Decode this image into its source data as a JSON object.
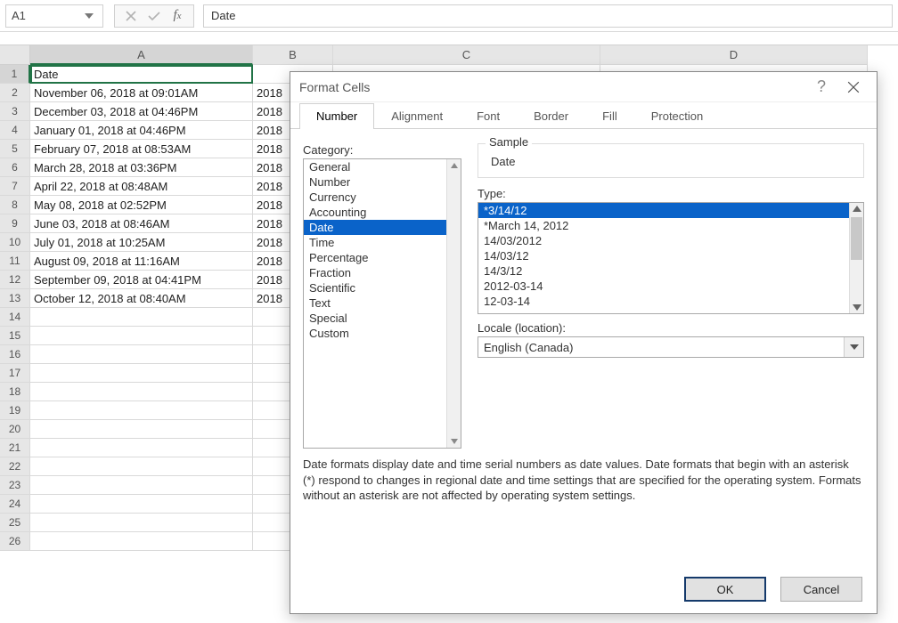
{
  "namebox": "A1",
  "formula_value": "Date",
  "columns": [
    "A",
    "B",
    "C",
    "D"
  ],
  "rows": [
    {
      "n": "1",
      "a": "Date",
      "b": ""
    },
    {
      "n": "2",
      "a": "November 06, 2018 at 09:01AM",
      "b": "2018"
    },
    {
      "n": "3",
      "a": "December 03, 2018 at 04:46PM",
      "b": "2018"
    },
    {
      "n": "4",
      "a": "January 01, 2018 at 04:46PM",
      "b": "2018"
    },
    {
      "n": "5",
      "a": "February 07, 2018 at 08:53AM",
      "b": "2018"
    },
    {
      "n": "6",
      "a": "March 28, 2018 at 03:36PM",
      "b": "2018"
    },
    {
      "n": "7",
      "a": "April 22, 2018 at 08:48AM",
      "b": "2018"
    },
    {
      "n": "8",
      "a": "May 08, 2018 at 02:52PM",
      "b": "2018"
    },
    {
      "n": "9",
      "a": "June 03, 2018 at 08:46AM",
      "b": "2018"
    },
    {
      "n": "10",
      "a": "July 01, 2018 at 10:25AM",
      "b": "2018"
    },
    {
      "n": "11",
      "a": "August 09, 2018 at 11:16AM",
      "b": "2018"
    },
    {
      "n": "12",
      "a": "September 09, 2018 at 04:41PM",
      "b": "2018"
    },
    {
      "n": "13",
      "a": "October 12, 2018 at 08:40AM",
      "b": "2018"
    },
    {
      "n": "14",
      "a": "",
      "b": ""
    },
    {
      "n": "15",
      "a": "",
      "b": ""
    },
    {
      "n": "16",
      "a": "",
      "b": ""
    },
    {
      "n": "17",
      "a": "",
      "b": ""
    },
    {
      "n": "18",
      "a": "",
      "b": ""
    },
    {
      "n": "19",
      "a": "",
      "b": ""
    },
    {
      "n": "20",
      "a": "",
      "b": ""
    },
    {
      "n": "21",
      "a": "",
      "b": ""
    },
    {
      "n": "22",
      "a": "",
      "b": ""
    },
    {
      "n": "23",
      "a": "",
      "b": ""
    },
    {
      "n": "24",
      "a": "",
      "b": ""
    },
    {
      "n": "25",
      "a": "",
      "b": ""
    },
    {
      "n": "26",
      "a": "",
      "b": ""
    }
  ],
  "dialog": {
    "title": "Format Cells",
    "help": "?",
    "tabs": [
      "Number",
      "Alignment",
      "Font",
      "Border",
      "Fill",
      "Protection"
    ],
    "active_tab": 0,
    "category_label": "Category:",
    "categories": [
      "General",
      "Number",
      "Currency",
      "Accounting",
      "Date",
      "Time",
      "Percentage",
      "Fraction",
      "Scientific",
      "Text",
      "Special",
      "Custom"
    ],
    "category_selected": 4,
    "sample_label": "Sample",
    "sample_value": "Date",
    "type_label": "Type:",
    "types": [
      "*3/14/12",
      "*March 14, 2012",
      "14/03/2012",
      "14/03/12",
      "14/3/12",
      "2012-03-14",
      "12-03-14"
    ],
    "type_selected": 0,
    "locale_label": "Locale (location):",
    "locale_value": "English (Canada)",
    "description": "Date formats display date and time serial numbers as date values.  Date formats that begin with an asterisk (*) respond to changes in regional date and time settings that are specified for the operating system. Formats without an asterisk are not affected by operating system settings.",
    "ok": "OK",
    "cancel": "Cancel"
  }
}
